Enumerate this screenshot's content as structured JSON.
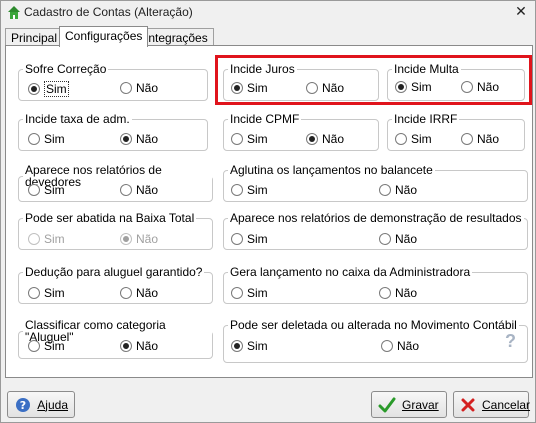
{
  "window": {
    "title": "Cadastro de Contas (Alteração)"
  },
  "tabs": [
    {
      "label": "Principal"
    },
    {
      "label": "Configurações"
    },
    {
      "label": "Integrações"
    }
  ],
  "groups": {
    "sofre_correcao": {
      "title": "Sofre Correção",
      "sim": "Sim",
      "nao": "Não",
      "selected": "sim"
    },
    "incide_juros": {
      "title": "Incide Juros",
      "sim": "Sim",
      "nao": "Não",
      "selected": "sim"
    },
    "incide_multa": {
      "title": "Incide Multa",
      "sim": "Sim",
      "nao": "Não",
      "selected": "sim"
    },
    "incide_taxa_adm": {
      "title": "Incide taxa de adm.",
      "sim": "Sim",
      "nao": "Não",
      "selected": "nao"
    },
    "incide_cpmf": {
      "title": "Incide CPMF",
      "sim": "Sim",
      "nao": "Não",
      "selected": "nao"
    },
    "incide_irrf": {
      "title": "Incide IRRF",
      "sim": "Sim",
      "nao": "Não",
      "selected": "none"
    },
    "aparece_devedores": {
      "title": "Aparece nos relatórios de devedores",
      "sim": "Sim",
      "nao": "Não",
      "selected": "none"
    },
    "aglutina_balancete": {
      "title": "Aglutina os lançamentos no balancete",
      "sim": "Sim",
      "nao": "Não",
      "selected": "none"
    },
    "abatida_baixa_total": {
      "title": "Pode ser abatida na Baixa Total",
      "sim": "Sim",
      "nao": "Não",
      "selected": "nao",
      "disabled": true
    },
    "aparece_demonstracao": {
      "title": "Aparece nos relatórios de demonstração de resultados",
      "sim": "Sim",
      "nao": "Não",
      "selected": "none"
    },
    "deducao_aluguel": {
      "title": "Dedução para aluguel garantido?",
      "sim": "Sim",
      "nao": "Não",
      "selected": "none"
    },
    "gera_lancamento_caixa": {
      "title": "Gera lançamento no caixa da Administradora",
      "sim": "Sim",
      "nao": "Não",
      "selected": "none"
    },
    "categoria_aluguel": {
      "title": "Classificar como categoria \"Aluguel\"",
      "sim": "Sim",
      "nao": "Não",
      "selected": "nao"
    },
    "deletada_movimento": {
      "title": "Pode ser deletada ou alterada no Movimento Contábil",
      "sim": "Sim",
      "nao": "Não",
      "selected": "sim"
    }
  },
  "help_mark": "?",
  "footer": {
    "ajuda": "Ajuda",
    "gravar": "Gravar",
    "cancelar": "Cancelar"
  },
  "colors": {
    "highlight": "#e0141c",
    "ok_green": "#2a9a2a",
    "cancel_red": "#d42020"
  }
}
